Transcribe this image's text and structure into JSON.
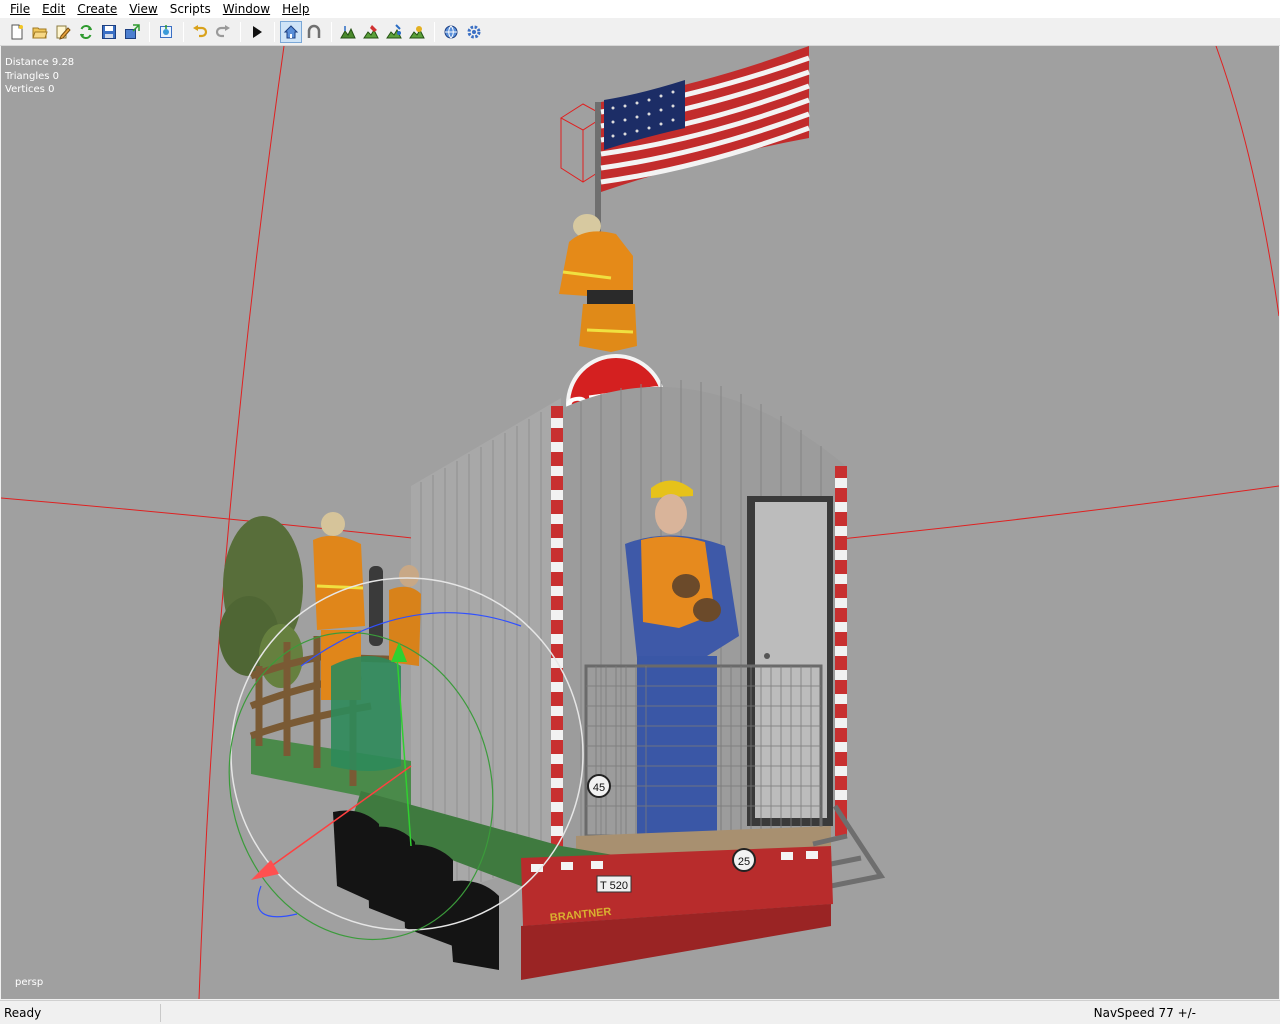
{
  "menu": {
    "file": "File",
    "edit": "Edit",
    "create": "Create",
    "view": "View",
    "scripts": "Scripts",
    "window": "Window",
    "help": "Help"
  },
  "toolbar": {
    "buttons": [
      {
        "name": "new-file-icon"
      },
      {
        "name": "open-file-icon"
      },
      {
        "name": "edit-file-icon"
      },
      {
        "name": "refresh-icon"
      },
      {
        "name": "save-icon"
      },
      {
        "name": "export-icon"
      },
      {
        "name": "import-icon"
      },
      {
        "name": "undo-icon"
      },
      {
        "name": "redo-icon"
      },
      {
        "name": "play-icon"
      },
      {
        "name": "home-icon",
        "active": true
      },
      {
        "name": "magnet-icon"
      },
      {
        "name": "terrain-icon"
      },
      {
        "name": "terrain-paint-icon"
      },
      {
        "name": "terrain-sculpt-icon"
      },
      {
        "name": "terrain-foliage-icon"
      },
      {
        "name": "globe-settings-icon"
      },
      {
        "name": "gear-settings-icon"
      }
    ]
  },
  "viewport": {
    "stats": {
      "distance": "Distance 9.28",
      "triangles": "Triangles 0",
      "vertices": "Vertices 0"
    },
    "camera": "persp",
    "scene": {
      "sign_text": "STOP",
      "plate_text": "T 520",
      "brand_text": "BRANTNER",
      "speed_badge_left": "45",
      "speed_badge_right": "25"
    },
    "colors": {
      "background": "#a0a0a0",
      "grid_line": "#e02020",
      "gizmo_red": "#ff4040",
      "gizmo_green": "#30d030",
      "gizmo_blue": "#3050ff"
    }
  },
  "status": {
    "left": "Ready",
    "right": "NavSpeed 77 +/-"
  }
}
